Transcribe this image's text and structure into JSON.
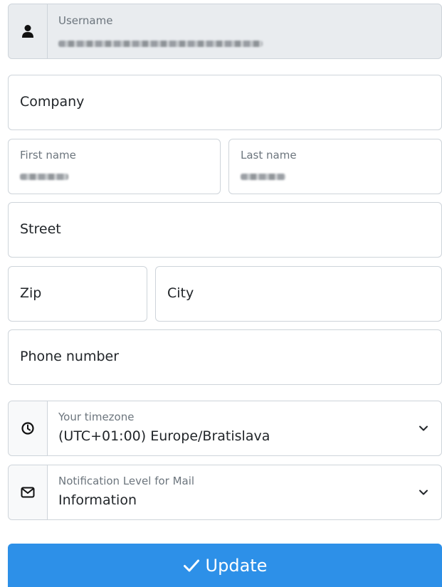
{
  "username": {
    "label": "Username",
    "icon": "user-icon"
  },
  "company": {
    "placeholder": "Company"
  },
  "first_name": {
    "label": "First name"
  },
  "last_name": {
    "label": "Last name"
  },
  "street": {
    "placeholder": "Street"
  },
  "zip": {
    "placeholder": "Zip"
  },
  "city": {
    "placeholder": "City"
  },
  "phone": {
    "placeholder": "Phone number"
  },
  "timezone": {
    "label": "Your timezone",
    "value": "(UTC+01:00) Europe/Bratislava",
    "icon": "clock-icon"
  },
  "notification": {
    "label": "Notification Level for Mail",
    "value": "Information",
    "icon": "envelope-icon"
  },
  "update_button": {
    "label": "Update",
    "icon": "check-icon"
  },
  "colors": {
    "accent": "#2d90e8",
    "readonly_bg": "#e9ecef",
    "border": "#ced4da"
  }
}
